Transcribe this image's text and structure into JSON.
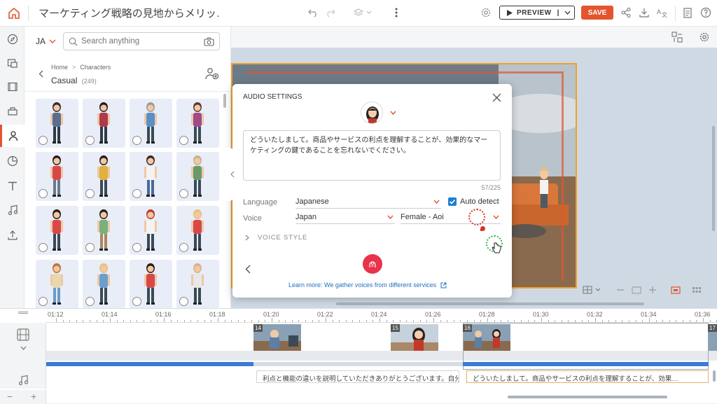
{
  "header": {
    "title": "マーケティング戦略の見地からメリッ…",
    "preview_label": "PREVIEW",
    "save_label": "SAVE"
  },
  "panel": {
    "lang": "JA",
    "search_placeholder": "Search anything",
    "crumb_home": "Home",
    "crumb_sep": ">",
    "crumb_current": "Characters",
    "category": "Casual",
    "count": "(249)"
  },
  "dialog": {
    "title": "AUDIO SETTINGS",
    "text": "どういたしまして。商品やサービスの利点を理解することが、効果的なマーケティングの鍵であることを忘れないでください。",
    "counter": "57/225",
    "language_label": "Language",
    "language_value": "Japanese",
    "auto_detect_label": "Auto detect",
    "voice_label": "Voice",
    "voice_region": "Japan",
    "voice_name": "Female - Aoi",
    "voice_style_label": "VOICE STYLE",
    "learn_more": "Learn more: We gather voices from different services"
  },
  "timeline": {
    "ticks": [
      "01:12",
      "01:14",
      "01:16",
      "01:18",
      "01:20",
      "01:22",
      "01:24",
      "01:26",
      "01:28",
      "01:30",
      "01:32",
      "01:34",
      "01:36"
    ],
    "scenes": [
      "14",
      "15",
      "16",
      "17"
    ],
    "captions": [
      "利点と機能の違いを説明していただきありがとうございます。自分…",
      "どういたしまして。商品やサービスの利点を理解することが、効果…"
    ]
  },
  "colors": {
    "accent": "#e2552f",
    "blue": "#3a7bd5",
    "checkbox": "#1e7fd1"
  }
}
